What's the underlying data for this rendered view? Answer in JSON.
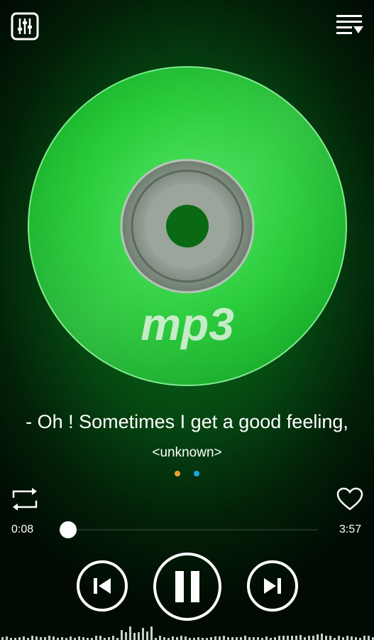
{
  "header": {
    "equalizer_icon": "equalizer-icon",
    "queue_icon": "queue-list-icon"
  },
  "album_art": {
    "label": "mp3",
    "color": "#17c52a"
  },
  "track": {
    "title": "- Oh ! Sometimes I get a good feeling,",
    "artist": "<unknown>"
  },
  "pager": {
    "dot_colors": [
      "#f0a030",
      "#1aa9e8"
    ]
  },
  "controls": {
    "repeat_icon": "repeat-icon",
    "favorite_icon": "heart-icon",
    "prev_icon": "skip-previous-icon",
    "play_pause_icon": "pause-icon",
    "next_icon": "skip-next-icon"
  },
  "progress": {
    "elapsed": "0:08",
    "total": "3:57",
    "fraction": 0.034
  }
}
